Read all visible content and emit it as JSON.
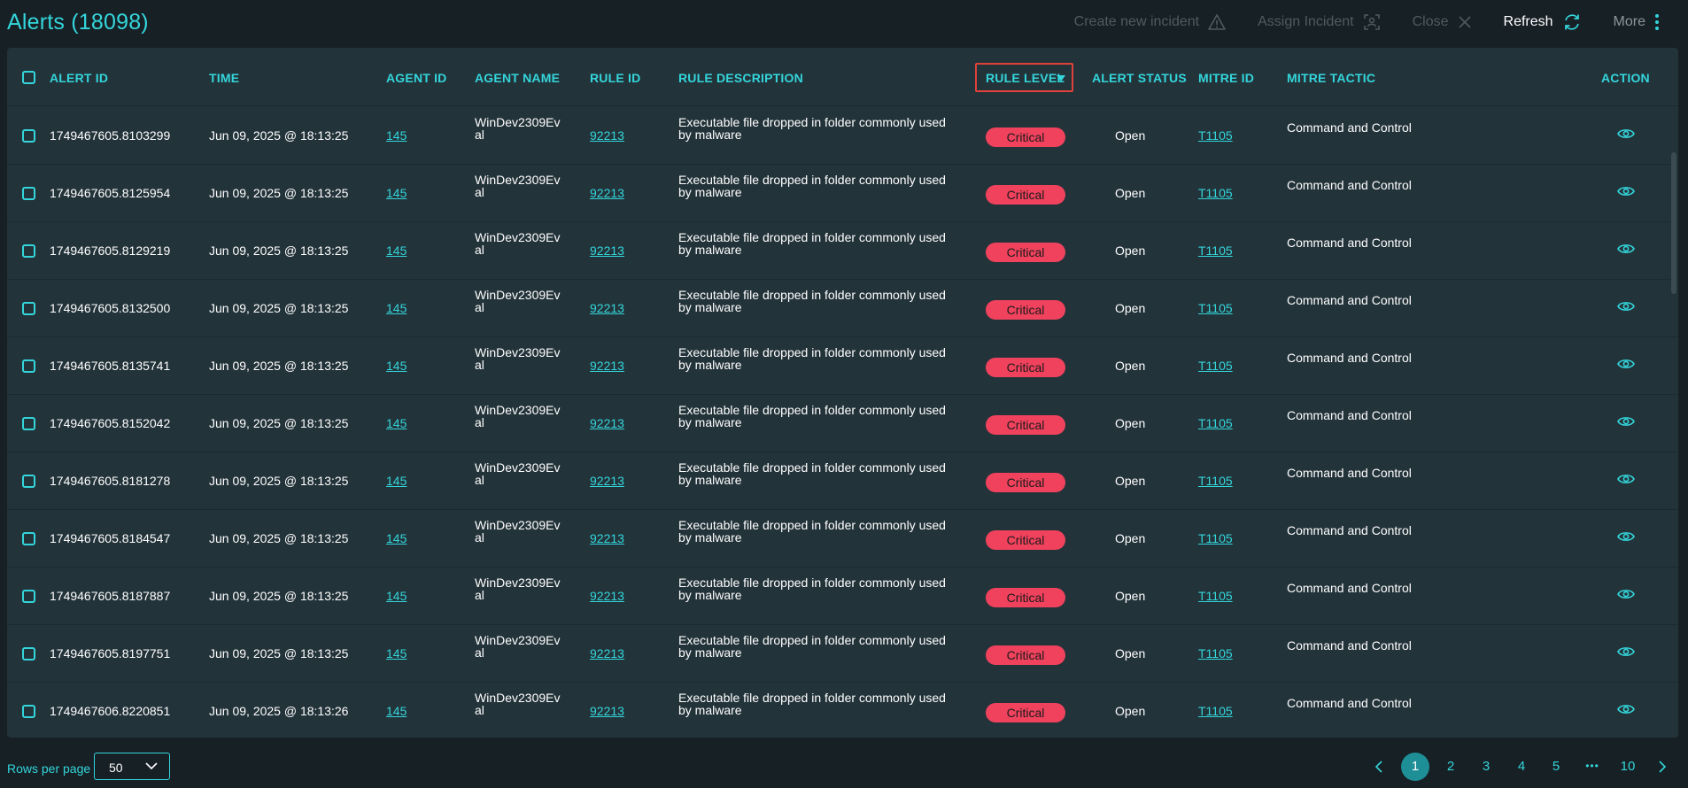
{
  "header": {
    "title": "Alerts (18098)",
    "actions": [
      {
        "label": "Create new incident",
        "icon": "warning-triangle-icon",
        "enabled": false
      },
      {
        "label": "Assign Incident",
        "icon": "assign-incident-icon",
        "enabled": false
      },
      {
        "label": "Close",
        "icon": "close-icon",
        "enabled": false
      },
      {
        "label": "Refresh",
        "icon": "refresh-icon",
        "enabled": true
      },
      {
        "label": "More",
        "icon": "kebab-menu-icon",
        "enabled": true
      }
    ]
  },
  "table": {
    "columns": {
      "alert_id": "ALERT ID",
      "time": "TIME",
      "agent_id": "AGENT ID",
      "agent_name": "AGENT NAME",
      "rule_id": "RULE ID",
      "rule_description": "RULE DESCRIPTION",
      "rule_level": "RULE LEVEL",
      "alert_status": "ALERT STATUS",
      "mitre_id": "MITRE ID",
      "mitre_tactic": "MITRE TACTIC",
      "action": "ACTION"
    },
    "sorted_column": "RULE LEVEL",
    "rows": [
      {
        "alert_id": "1749467605.8103299",
        "time": "Jun 09, 2025 @ 18:13:25",
        "agent_id": "145",
        "agent_name": "WinDev2309Ev al",
        "rule_id": "92213",
        "rule_description": "Executable file dropped in folder commonly used by malware",
        "rule_level": "Critical",
        "alert_status": "Open",
        "mitre_id": "T1105",
        "mitre_tactic": "Command and Control"
      },
      {
        "alert_id": "1749467605.8125954",
        "time": "Jun 09, 2025 @ 18:13:25",
        "agent_id": "145",
        "agent_name": "WinDev2309Ev al",
        "rule_id": "92213",
        "rule_description": "Executable file dropped in folder commonly used by malware",
        "rule_level": "Critical",
        "alert_status": "Open",
        "mitre_id": "T1105",
        "mitre_tactic": "Command and Control"
      },
      {
        "alert_id": "1749467605.8129219",
        "time": "Jun 09, 2025 @ 18:13:25",
        "agent_id": "145",
        "agent_name": "WinDev2309Ev al",
        "rule_id": "92213",
        "rule_description": "Executable file dropped in folder commonly used by malware",
        "rule_level": "Critical",
        "alert_status": "Open",
        "mitre_id": "T1105",
        "mitre_tactic": "Command and Control"
      },
      {
        "alert_id": "1749467605.8132500",
        "time": "Jun 09, 2025 @ 18:13:25",
        "agent_id": "145",
        "agent_name": "WinDev2309Ev al",
        "rule_id": "92213",
        "rule_description": "Executable file dropped in folder commonly used by malware",
        "rule_level": "Critical",
        "alert_status": "Open",
        "mitre_id": "T1105",
        "mitre_tactic": "Command and Control"
      },
      {
        "alert_id": "1749467605.8135741",
        "time": "Jun 09, 2025 @ 18:13:25",
        "agent_id": "145",
        "agent_name": "WinDev2309Ev al",
        "rule_id": "92213",
        "rule_description": "Executable file dropped in folder commonly used by malware",
        "rule_level": "Critical",
        "alert_status": "Open",
        "mitre_id": "T1105",
        "mitre_tactic": "Command and Control"
      },
      {
        "alert_id": "1749467605.8152042",
        "time": "Jun 09, 2025 @ 18:13:25",
        "agent_id": "145",
        "agent_name": "WinDev2309Ev al",
        "rule_id": "92213",
        "rule_description": "Executable file dropped in folder commonly used by malware",
        "rule_level": "Critical",
        "alert_status": "Open",
        "mitre_id": "T1105",
        "mitre_tactic": "Command and Control"
      },
      {
        "alert_id": "1749467605.8181278",
        "time": "Jun 09, 2025 @ 18:13:25",
        "agent_id": "145",
        "agent_name": "WinDev2309Ev al",
        "rule_id": "92213",
        "rule_description": "Executable file dropped in folder commonly used by malware",
        "rule_level": "Critical",
        "alert_status": "Open",
        "mitre_id": "T1105",
        "mitre_tactic": "Command and Control"
      },
      {
        "alert_id": "1749467605.8184547",
        "time": "Jun 09, 2025 @ 18:13:25",
        "agent_id": "145",
        "agent_name": "WinDev2309Ev al",
        "rule_id": "92213",
        "rule_description": "Executable file dropped in folder commonly used by malware",
        "rule_level": "Critical",
        "alert_status": "Open",
        "mitre_id": "T1105",
        "mitre_tactic": "Command and Control"
      },
      {
        "alert_id": "1749467605.8187887",
        "time": "Jun 09, 2025 @ 18:13:25",
        "agent_id": "145",
        "agent_name": "WinDev2309Ev al",
        "rule_id": "92213",
        "rule_description": "Executable file dropped in folder commonly used by malware",
        "rule_level": "Critical",
        "alert_status": "Open",
        "mitre_id": "T1105",
        "mitre_tactic": "Command and Control"
      },
      {
        "alert_id": "1749467605.8197751",
        "time": "Jun 09, 2025 @ 18:13:25",
        "agent_id": "145",
        "agent_name": "WinDev2309Ev al",
        "rule_id": "92213",
        "rule_description": "Executable file dropped in folder commonly used by malware",
        "rule_level": "Critical",
        "alert_status": "Open",
        "mitre_id": "T1105",
        "mitre_tactic": "Command and Control"
      },
      {
        "alert_id": "1749467606.8220851",
        "time": "Jun 09, 2025 @ 18:13:26",
        "agent_id": "145",
        "agent_name": "WinDev2309Ev al",
        "rule_id": "92213",
        "rule_description": "Executable file dropped in folder commonly used by malware",
        "rule_level": "Critical",
        "alert_status": "Open",
        "mitre_id": "T1105",
        "mitre_tactic": "Command and Control"
      }
    ]
  },
  "footer": {
    "rows_per_page_label": "Rows per page",
    "rows_per_page_value": "50",
    "pages": [
      "1",
      "2",
      "3",
      "4",
      "5",
      "10"
    ],
    "ellipsis": "•••",
    "current_page": "1",
    "prev_icon": "chevron-left-icon",
    "next_icon": "chevron-right-icon"
  },
  "colors": {
    "accent": "#33d6db",
    "critical": "#f0425d",
    "background": "#172025",
    "panel": "#23333a",
    "highlight_box": "#e0413a"
  }
}
